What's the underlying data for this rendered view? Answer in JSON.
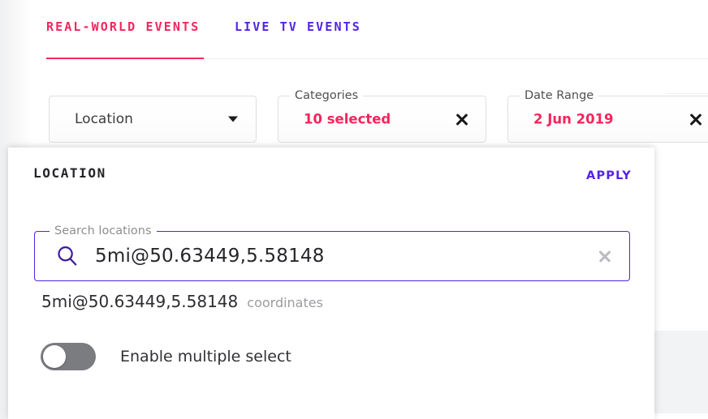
{
  "tabs": [
    {
      "label": "REAL-WORLD EVENTS",
      "color": "#f4255d",
      "active": true
    },
    {
      "label": "LIVE TV EVENTS",
      "color": "#5423e6",
      "active": false
    }
  ],
  "filters": [
    {
      "name": "location",
      "legend": "",
      "value": "Location",
      "control": "dropdown-caret"
    },
    {
      "name": "categories",
      "legend": "Categories",
      "value": "10 selected",
      "control": "clear-x"
    },
    {
      "name": "date_range",
      "legend": "Date Range",
      "value": "2 Jun 2019",
      "control": "clear-x"
    }
  ],
  "panel": {
    "title": "LOCATION",
    "apply_label": "APPLY",
    "search": {
      "legend": "Search locations",
      "value": "5mi@50.63449,5.58148",
      "placeholder": "Search locations",
      "icon": "search-icon",
      "clear_icon": "close-icon"
    },
    "suggestions": [
      {
        "text": "5mi@50.63449,5.58148",
        "type": "coordinates"
      }
    ],
    "toggle": {
      "label": "Enable multiple select",
      "state": "off"
    }
  },
  "colors": {
    "accent_pink": "#f4255d",
    "accent_purple": "#5423e6",
    "border_gray": "#dedfe1",
    "text_dark": "#26272b",
    "text_muted": "#9b9ca0"
  }
}
